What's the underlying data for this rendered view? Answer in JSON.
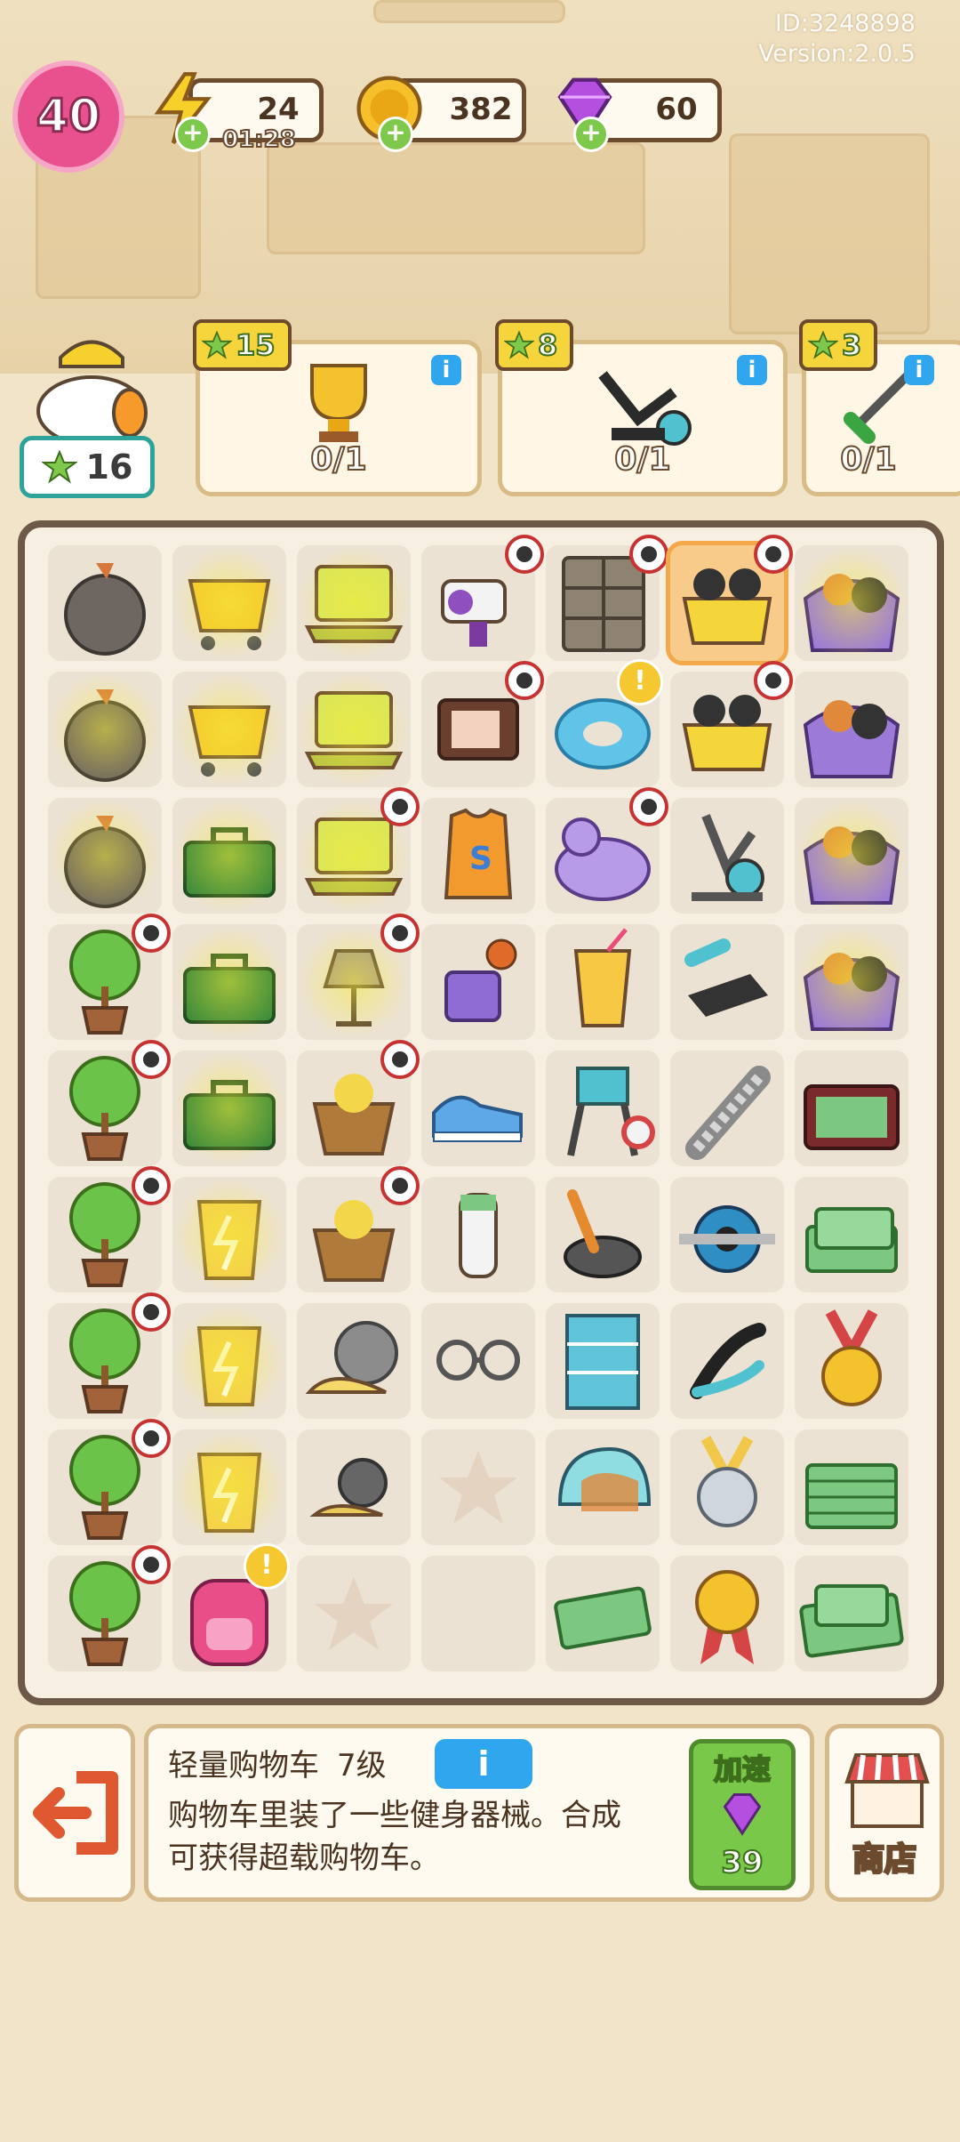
{
  "meta": {
    "id_text": "ID:3248898",
    "version_text": "Version:2.0.5"
  },
  "player": {
    "level": "40"
  },
  "resources": {
    "energy": {
      "value": "24",
      "timer": "01:28",
      "icon": "lightning-icon"
    },
    "coins": {
      "value": "382",
      "icon": "coin-icon"
    },
    "gems": {
      "value": "60",
      "icon": "gem-icon"
    }
  },
  "points": {
    "value": "16"
  },
  "quests": [
    {
      "reward": "15",
      "progress": "0/1",
      "icon": "trophy-icon"
    },
    {
      "reward": "8",
      "progress": "0/1",
      "icon": "exercise-bike-icon"
    },
    {
      "reward": "3",
      "progress": "0/1",
      "icon": "hacksaw-icon"
    }
  ],
  "board": {
    "rows": [
      [
        "garbage-bag",
        "shopping-cart",
        "laptop",
        "camcorder",
        "filing-cabinet",
        "cart-with-gym-gear",
        "purple-bag-of-gear"
      ],
      [
        "garbage-bag",
        "shopping-cart",
        "laptop",
        "retro-tv",
        "inflatable-ring",
        "cart-with-gym-gear",
        "purple-bag-of-gear"
      ],
      [
        "garbage-bag",
        "toolbox",
        "laptop",
        "jersey",
        "unicorn-float",
        "elliptical-machine",
        "purple-bag-of-gear"
      ],
      [
        "potted-tree",
        "toolbox",
        "glowing-lamp",
        "basketball-machine",
        "orange-drink",
        "bench-press",
        "purple-bag-of-gear"
      ],
      [
        "potted-tree",
        "toolbox",
        "flower-basket",
        "sneakers",
        "lifeguard-chair",
        "grip-strengthener",
        "money-suitcase"
      ],
      [
        "potted-tree",
        "bucket",
        "flower-basket",
        "hair-clipper",
        "frying-pan",
        "ab-roller",
        "cash-pile"
      ],
      [
        "potted-tree",
        "bucket",
        "snail",
        "glasses",
        "building",
        "hand-gripper",
        "gold-medal"
      ],
      [
        "potted-tree",
        "bucket",
        "small-snail",
        "empty-star",
        "helmet",
        "silver-medal",
        "cash-stack"
      ],
      [
        "potted-tree",
        "backpack",
        "empty-star",
        "empty",
        "banknote",
        "badge-ribbon",
        "cash-bundle"
      ]
    ]
  },
  "selected_item": {
    "name": "轻量购物车",
    "level": "7级",
    "description": "购物车里装了一些健身器械。合成可获得超载购物车。",
    "speedup_label": "加速",
    "speedup_cost": "39"
  },
  "shop": {
    "label": "商店"
  },
  "colors": {
    "accent": "#6b4a2e",
    "gem": "#b44fe0",
    "speedup": "#79c84a"
  }
}
